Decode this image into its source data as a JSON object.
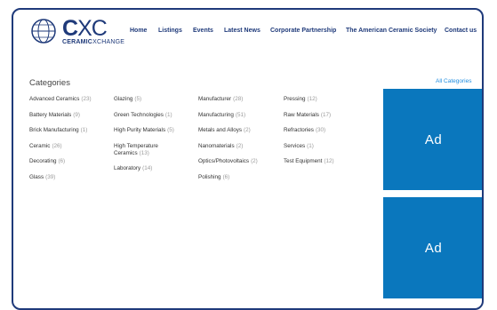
{
  "logo": {
    "brand_bold": "C",
    "brand_rest": "XC",
    "sub_bold": "CERAMIC",
    "sub_rest": "XCHANGE"
  },
  "nav": [
    "Home",
    "Listings",
    "Events",
    "Latest News",
    "Corporate Partnership",
    "The American Ceramic Society",
    "Contact us"
  ],
  "categories": {
    "title": "Categories",
    "all_link": "All Categories",
    "columns": [
      [
        {
          "name": "Advanced Ceramics",
          "count": "(23)"
        },
        {
          "name": "Battery Materials",
          "count": "(9)"
        },
        {
          "name": "Brick Manufacturing",
          "count": "(1)"
        },
        {
          "name": "Ceramic",
          "count": "(26)"
        },
        {
          "name": "Decorating",
          "count": "(6)"
        },
        {
          "name": "Glass",
          "count": "(39)"
        }
      ],
      [
        {
          "name": "Glazing",
          "count": "(5)"
        },
        {
          "name": "Green Technologies",
          "count": "(1)"
        },
        {
          "name": "High Purity Materials",
          "count": "(5)"
        },
        {
          "name": "High Temperature Ceramics",
          "count": "(13)"
        },
        {
          "name": "Laboratory",
          "count": "(14)"
        }
      ],
      [
        {
          "name": "Manufacturer",
          "count": "(28)"
        },
        {
          "name": "Manufacturing",
          "count": "(51)"
        },
        {
          "name": "Metals and Alloys",
          "count": "(2)"
        },
        {
          "name": "Nanomaterials",
          "count": "(2)"
        },
        {
          "name": "Optics/Photovoltaics",
          "count": "(2)"
        },
        {
          "name": "Polishing",
          "count": "(6)"
        }
      ],
      [
        {
          "name": "Pressing",
          "count": "(12)"
        },
        {
          "name": "Raw Materials",
          "count": "(17)"
        },
        {
          "name": "Refractories",
          "count": "(30)"
        },
        {
          "name": "Services",
          "count": "(1)"
        },
        {
          "name": "Test Equipment",
          "count": "(12)"
        }
      ]
    ]
  },
  "ads": [
    "Ad",
    "Ad"
  ],
  "colors": {
    "brand": "#1f3a7a",
    "link": "#1f8de0",
    "ad": "#0a77bd"
  }
}
